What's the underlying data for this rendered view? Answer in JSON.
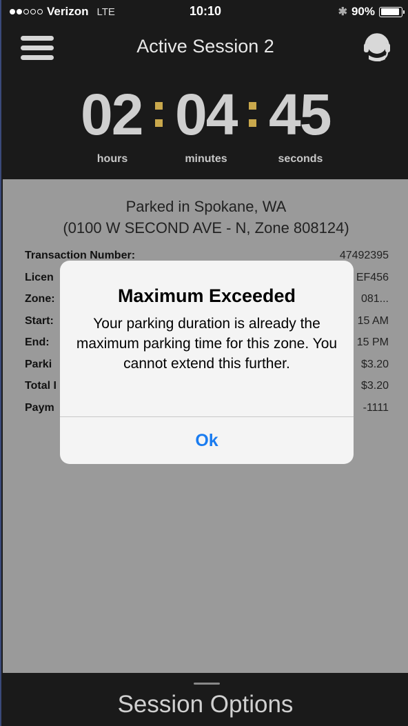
{
  "status_bar": {
    "carrier": "Verizon",
    "network": "LTE",
    "time": "10:10",
    "battery": "90%",
    "battery_level": 0.9,
    "signal_bars_filled": 2,
    "signal_bars_total": 5,
    "icons": {
      "bluetooth": "bluetooth-icon",
      "battery": "battery-icon"
    }
  },
  "header": {
    "title": "Active Session 2",
    "menu_icon": "hamburger-icon",
    "support_icon": "headset-icon"
  },
  "timer": {
    "hours": "02",
    "minutes": "04",
    "seconds": "45",
    "hours_label": "hours",
    "minutes_label": "minutes",
    "seconds_label": "seconds",
    "colon_color": "#c9a84c"
  },
  "session": {
    "location_line1": "Parked in Spokane, WA",
    "location_line2": "(0100 W SECOND AVE - N, Zone 808124)",
    "rows": [
      {
        "label": "Transaction Number:",
        "value": "47492395"
      },
      {
        "label": "Licen",
        "value": "EF456"
      },
      {
        "label": "Zone:",
        "value": "081..."
      },
      {
        "label": "Start:",
        "value": "15 AM"
      },
      {
        "label": "End:",
        "value": "15 PM"
      },
      {
        "label": "Parki",
        "value": "$3.20"
      },
      {
        "label": "Total I",
        "value": "$3.20"
      },
      {
        "label": "Paym",
        "value": "-1111"
      }
    ]
  },
  "alert": {
    "title": "Maximum Exceeded",
    "message": "Your parking duration is already the maximum parking time for this zone. You cannot extend this further.",
    "ok_label": "Ok",
    "ok_color": "#1a7cf0"
  },
  "bottom_bar": {
    "label": "Session Options"
  }
}
